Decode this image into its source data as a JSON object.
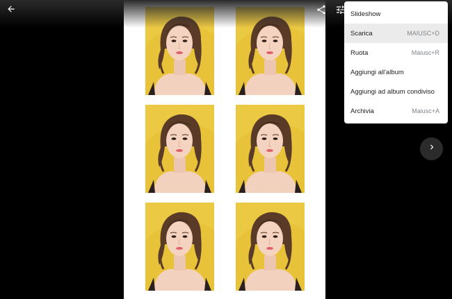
{
  "viewer": {
    "background": "#000000",
    "toolbar": {
      "back_icon": "arrow-left-icon",
      "share_icon": "share-icon",
      "adjust_icon": "tune-icon"
    },
    "next_icon": "chevron-right-icon",
    "photo_grid": {
      "rows": 3,
      "columns": 2,
      "photo_background": "#e8c33a"
    }
  },
  "menu": {
    "items": [
      {
        "label": "Slideshow",
        "shortcut": ""
      },
      {
        "label": "Scarica",
        "shortcut": "MAIUSC+D"
      },
      {
        "label": "Ruota",
        "shortcut": "Maiusc+R"
      },
      {
        "label": "Aggiungi all'album",
        "shortcut": ""
      },
      {
        "label": "Aggiungi ad album condiviso",
        "shortcut": ""
      },
      {
        "label": "Archivia",
        "shortcut": "Maiusc+A"
      }
    ]
  }
}
